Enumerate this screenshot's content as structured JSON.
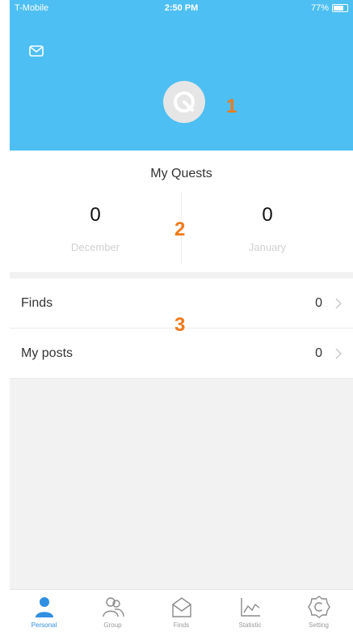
{
  "status_bar": {
    "carrier": "T-Mobile",
    "time": "2:50 PM",
    "battery": "77%",
    "battery_level": 0.77
  },
  "header": {
    "mail_icon": "mail-icon",
    "avatar_icon": "q-logo-icon",
    "marker": "1"
  },
  "quests": {
    "title": "My Quests",
    "columns": [
      {
        "count": "0",
        "month": "December"
      },
      {
        "count": "0",
        "month": "January"
      }
    ],
    "marker": "2"
  },
  "list": {
    "rows": [
      {
        "label": "Finds",
        "count": "0"
      },
      {
        "label": "My posts",
        "count": "0"
      }
    ],
    "marker": "3"
  },
  "tabs": [
    {
      "label": "Personal",
      "icon": "person-icon",
      "active": true
    },
    {
      "label": "Group",
      "icon": "group-icon",
      "active": false
    },
    {
      "label": "Finds",
      "icon": "envelope-icon",
      "active": false
    },
    {
      "label": "Statistic",
      "icon": "chart-icon",
      "active": false
    },
    {
      "label": "Setting",
      "icon": "gear-icon",
      "active": false
    }
  ],
  "colors": {
    "header": "#4dbff2",
    "marker": "#f07a1a",
    "active_tab": "#2f8fe0"
  }
}
